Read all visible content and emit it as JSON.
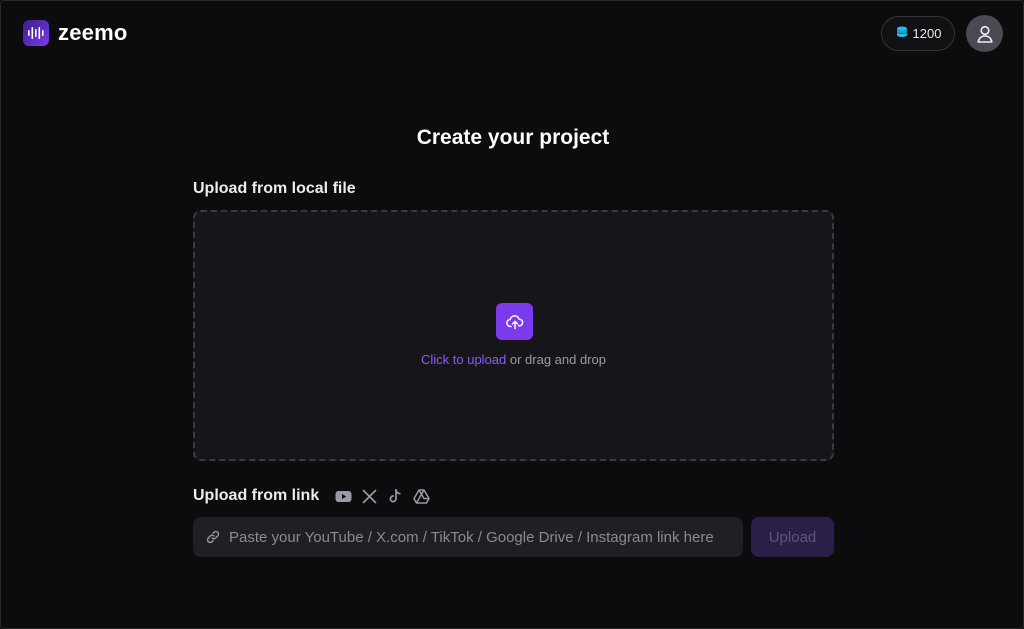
{
  "header": {
    "brand": "zeemo",
    "credits": "1200",
    "logo_icon": "waveform-icon",
    "credits_icon": "coins-icon",
    "avatar_icon": "user-icon"
  },
  "main": {
    "title": "Create your project",
    "local_file": {
      "label": "Upload from local file",
      "upload_icon": "cloud-upload-icon",
      "click_text": "Click to upload",
      "drag_text": " or drag and drop"
    },
    "link": {
      "label": "Upload from link",
      "platforms": [
        "youtube-icon",
        "x-icon",
        "tiktok-icon",
        "google-drive-icon"
      ],
      "placeholder": "Paste your YouTube / X.com / TikTok / Google Drive / Instagram link here",
      "value": "",
      "submit_label": "Upload"
    }
  },
  "colors": {
    "accent": "#7c3aed",
    "accent_text": "#8b5cf6",
    "credits_icon": "#22c1e8",
    "background": "#0c0c0e"
  }
}
